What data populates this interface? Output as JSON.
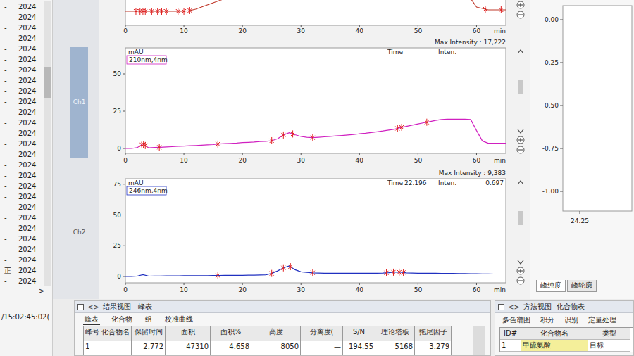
{
  "sidebar": {
    "items": [
      {
        "prefix": "-",
        "label": "2024"
      },
      {
        "prefix": "-",
        "label": "2024"
      },
      {
        "prefix": "-",
        "label": "2024"
      },
      {
        "prefix": "-",
        "label": "2024"
      },
      {
        "prefix": "-",
        "label": "2024"
      },
      {
        "prefix": "-",
        "label": "2024"
      },
      {
        "prefix": "-",
        "label": "2024"
      },
      {
        "prefix": "-",
        "label": "2024"
      },
      {
        "prefix": "-",
        "label": "2024"
      },
      {
        "prefix": "-",
        "label": "2024"
      },
      {
        "prefix": "-",
        "label": "2024"
      },
      {
        "prefix": "-",
        "label": "2024"
      },
      {
        "prefix": "-",
        "label": "2024"
      },
      {
        "prefix": "-",
        "label": "2024"
      },
      {
        "prefix": "-",
        "label": "2024"
      },
      {
        "prefix": "-",
        "label": "2024"
      },
      {
        "prefix": "-",
        "label": "2024"
      },
      {
        "prefix": "-",
        "label": "2024"
      },
      {
        "prefix": "-",
        "label": "2024"
      },
      {
        "prefix": "-",
        "label": "2024"
      },
      {
        "prefix": "-",
        "label": "2024"
      },
      {
        "prefix": "-",
        "label": "2024"
      },
      {
        "prefix": "-",
        "label": "2024"
      },
      {
        "prefix": "-",
        "label": "2024"
      },
      {
        "prefix": "-",
        "label": "2024"
      },
      {
        "prefix": "正",
        "label": "2024"
      },
      {
        "prefix": "-",
        "label": "2024"
      }
    ],
    "more": ">",
    "timestamp": "/15:02:45:02("
  },
  "channels": [
    {
      "label": "Ch1",
      "selected": true
    },
    {
      "label": "Ch2",
      "selected": false
    }
  ],
  "top_chart": {
    "x_ticks": [
      "0",
      "10",
      "20",
      "30",
      "40",
      "50",
      "60"
    ],
    "x_unit": "min",
    "color": "#c0392b",
    "values": [
      11,
      11,
      11,
      11,
      11,
      11,
      11,
      11,
      11,
      11,
      11,
      11.5,
      12.5,
      14,
      15.5,
      17,
      18.5,
      20,
      21.5,
      23,
      24.5,
      26,
      27.5,
      29,
      30,
      30,
      30,
      30,
      30,
      30,
      30,
      30,
      30,
      30,
      30,
      30,
      30,
      30,
      30,
      30,
      30,
      30,
      30,
      30,
      30,
      30,
      30,
      30,
      30,
      30,
      30,
      30,
      30,
      30,
      30,
      30,
      30,
      30,
      30,
      20,
      14,
      13,
      12,
      12,
      12,
      12
    ],
    "markers": [
      1.8,
      2.5,
      3,
      3.4,
      4.5,
      5.5,
      6.2,
      7,
      9,
      10,
      11,
      61.5,
      64.2
    ]
  },
  "charts": [
    {
      "max_intensity": "Max Intensity : 17,222",
      "wavelength": "210nm,4nm",
      "y_unit": "mAU",
      "time_label": "Time",
      "time_value": "",
      "inten_label": "Inten.",
      "inten_value": "",
      "color": "#d020c0",
      "y_ticks": [
        "0",
        "25",
        "50"
      ],
      "x_ticks": [
        "0",
        "10",
        "20",
        "30",
        "40",
        "50",
        "60"
      ],
      "x_unit": "min",
      "values": [
        0,
        0,
        0.5,
        3,
        0.4,
        0.6,
        0.8,
        1.0,
        1.2,
        1.4,
        1.6,
        1.8,
        2.0,
        2.2,
        2.4,
        2.6,
        3.0,
        3.2,
        3.4,
        3.6,
        3.9,
        4.1,
        4.3,
        4.6,
        4.8,
        5.2,
        6.5,
        9.0,
        10.5,
        9.2,
        8.0,
        7.5,
        7.2,
        7.5,
        7.8,
        8.1,
        8.4,
        8.7,
        9.0,
        9.4,
        9.8,
        10.2,
        10.7,
        11.2,
        11.7,
        12.3,
        12.9,
        14.0,
        14.8,
        15.6,
        16.4,
        17.2,
        18.0,
        18.8,
        19.4,
        19.6,
        19.6,
        19.6,
        19.6,
        19.4,
        12.0,
        5.0,
        3.5,
        3.5,
        3.5,
        3.5
      ],
      "markers": [
        2.8,
        3.1,
        3.4,
        5.8,
        15.8,
        25,
        27,
        28.6,
        32,
        46.5,
        47.2,
        51.5
      ]
    },
    {
      "max_intensity": "Max Intensity : 9,383",
      "wavelength": "246nm,4nm",
      "y_unit": "mAU",
      "time_label": "Time",
      "time_value": "22.196",
      "inten_label": "Inten.",
      "inten_value": "0.697",
      "color": "#2030c0",
      "y_ticks": [
        "0",
        "25",
        "50",
        "75"
      ],
      "x_ticks": [
        "0",
        "10",
        "20",
        "30",
        "40",
        "50",
        "60"
      ],
      "x_unit": "min",
      "values": [
        0,
        0,
        0.3,
        1.5,
        0.3,
        0.4,
        0.4,
        0.5,
        0.5,
        0.5,
        0.6,
        0.6,
        0.6,
        0.7,
        0.7,
        0.8,
        0.8,
        0.9,
        0.9,
        1.0,
        1.0,
        1.1,
        1.1,
        1.2,
        1.3,
        2.5,
        4.5,
        7.0,
        8.6,
        5.5,
        3.8,
        3.3,
        3.0,
        2.8,
        2.7,
        2.7,
        2.6,
        2.6,
        2.6,
        2.6,
        2.6,
        2.6,
        2.7,
        2.7,
        2.8,
        3.1,
        3.6,
        3.5,
        3.0,
        2.8,
        2.7,
        2.7,
        2.6,
        2.6,
        2.5,
        2.5,
        2.5,
        2.4,
        2.4,
        2.3,
        2.2,
        2.1,
        2.1,
        2.0,
        2.0,
        2.0
      ],
      "markers": [
        15.8,
        25,
        27,
        28.2,
        32,
        44.6,
        45.8,
        46.8,
        47.5
      ]
    }
  ],
  "purity": {
    "y_ticks": [
      "0.00",
      "-0.25",
      "-0.50",
      "-0.75",
      "-1.00"
    ],
    "x_tick": "24.25",
    "tabs": [
      {
        "label": "峰纯度",
        "selected": true
      },
      {
        "label": "峰轮廓",
        "selected": false
      }
    ]
  },
  "results": {
    "nav_glyph": "<>",
    "title": "结果视图 - 峰表",
    "tabs": [
      {
        "label": "峰表",
        "selected": true
      },
      {
        "label": "化合物",
        "selected": false
      },
      {
        "label": "组",
        "selected": false
      },
      {
        "label": "校准曲线",
        "selected": false
      }
    ],
    "columns": [
      "峰号",
      "化合物名",
      "保留时间",
      "面积",
      "面积%",
      "高度",
      "分离度(",
      "S/N",
      "理论塔板",
      "拖尾因子"
    ],
    "rows": [
      {
        "cells": [
          "1",
          "",
          "2.772",
          "47310",
          "4.658",
          "8050",
          "—",
          "194.55",
          "5168",
          "3.279"
        ],
        "selected": false
      }
    ]
  },
  "method": {
    "nav_glyph": "<>",
    "title": "方法视图 -化合物表",
    "tabs": [
      {
        "label": "多色谱图",
        "selected": false
      },
      {
        "label": "积分",
        "selected": false
      },
      {
        "label": "识别",
        "selected": false
      },
      {
        "label": "定量处理",
        "selected": false
      }
    ],
    "columns": [
      "ID#",
      "化合物名",
      "类型"
    ],
    "rows": [
      {
        "cells": [
          "1",
          "甲硫氨酸",
          "目标"
        ],
        "selected": true
      }
    ]
  }
}
